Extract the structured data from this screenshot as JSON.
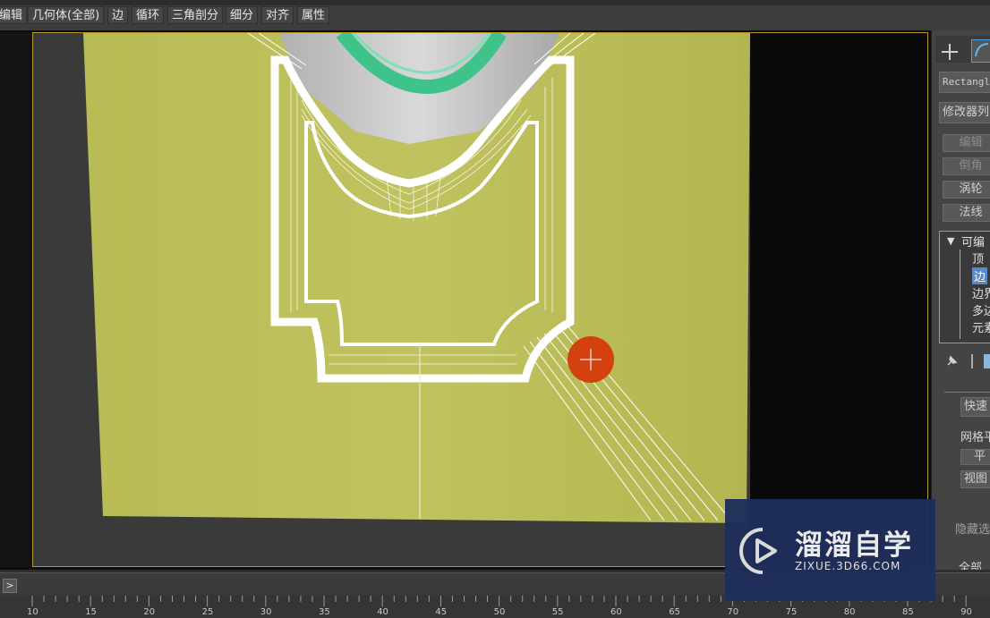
{
  "toolbar": {
    "items": [
      "编辑",
      "几何体(全部)",
      "边",
      "循环",
      "三角剖分",
      "细分",
      "对齐",
      "属性"
    ]
  },
  "panel": {
    "object_name": "Rectangl",
    "modifier_list": "修改器列",
    "buttons": [
      "编辑",
      "倒角",
      "涡轮",
      "法线"
    ],
    "stack": {
      "root": "可编",
      "items": [
        "顶",
        "边",
        "边界",
        "多边",
        "元素"
      ],
      "selected_index": 1
    },
    "quick_button": "快速",
    "grid_label": "网格平",
    "flat_button": "平",
    "view_button": "视图",
    "hide_label": "隐藏选",
    "bottom_label": "全部"
  },
  "timeline": {
    "arrow": ">",
    "ticks": [
      "10",
      "15",
      "20",
      "25",
      "30",
      "35",
      "40",
      "45",
      "50",
      "55",
      "60",
      "65",
      "70",
      "75",
      "80",
      "85",
      "90"
    ]
  },
  "watermark": {
    "title": "溜溜自学",
    "subtitle": "ZIXUE.3D66.COM"
  },
  "colors": {
    "surface": "#b8bb57",
    "accent_cursor": "#d2410f",
    "selection": "#5b88c8"
  }
}
